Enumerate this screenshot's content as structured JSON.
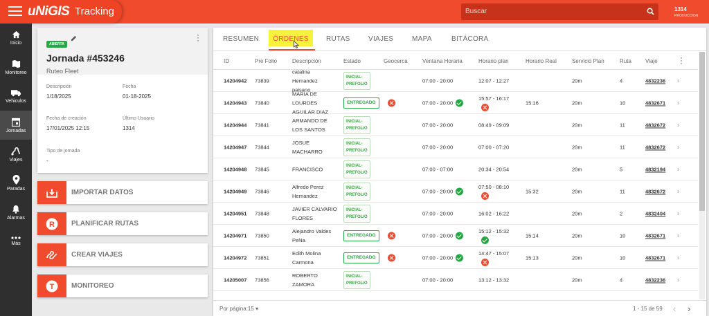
{
  "header": {
    "logo": "uNiGIS",
    "app_title": "Tracking",
    "search_placeholder": "Buscar",
    "user_id": "1314",
    "user_role": "PRODUCCION"
  },
  "sidebar": {
    "items": [
      {
        "label": "Inicio",
        "icon": "home-icon"
      },
      {
        "label": "Monitoreo",
        "icon": "map-icon"
      },
      {
        "label": "Vehiculos",
        "icon": "truck-icon"
      },
      {
        "label": "Jornadas",
        "icon": "calendar-icon"
      },
      {
        "label": "Viajes",
        "icon": "route-icon"
      },
      {
        "label": "Paradas",
        "icon": "pin-icon"
      },
      {
        "label": "Alarmas",
        "icon": "bell-icon"
      },
      {
        "label": "Más",
        "icon": "more-icon"
      }
    ]
  },
  "jornada": {
    "status": "ABIERTA",
    "title": "Jornada #453246",
    "subtitle": "Ruteo Fleet",
    "descripcion_label": "Descripción",
    "descripcion": "1/18/2025",
    "fecha_label": "Fecha",
    "fecha": "01-18-2025",
    "creacion_label": "Fecha de creación",
    "creacion": "17/01/2025 12:15",
    "usuario_label": "Último Usuario",
    "usuario": "1314",
    "tipo_label": "Tipo de jornada",
    "tipo": "-"
  },
  "actions": [
    "IMPORTAR DATOS",
    "PLANIFICAR RUTAS",
    "CREAR VIAJES",
    "MONITOREO"
  ],
  "tabs": [
    "RESUMEN",
    "ÓRDENES",
    "RUTAS",
    "VIAJES",
    "MAPA",
    "BITÁCORA"
  ],
  "columns": [
    "ID",
    "Pre Folio",
    "Descripción",
    "Estado",
    "Geocerca",
    "Ventana Horaria",
    "Horario plan",
    "Horario Real",
    "Servicio Plan",
    "Ruta",
    "Viaje"
  ],
  "rows": [
    {
      "id": "14204942",
      "folio": "73839",
      "desc": [
        "catalina",
        "Hernandez",
        "paisano"
      ],
      "estado": "INICIAL-PREFOLIO",
      "geo": false,
      "ventana": "07:00 - 20:00",
      "ventana_ok": false,
      "plan": "12:07 - 12:27",
      "plan_icon": "",
      "real": "",
      "servicio": "20m",
      "ruta": "4",
      "viaje": "4832236"
    },
    {
      "id": "14204943",
      "folio": "73840",
      "desc": [
        "MARIA DE",
        "LOURDES",
        "AGUILAR DIAZ"
      ],
      "estado": "ENTREGADO",
      "geo": true,
      "ventana": "07:00 - 20:00",
      "ventana_ok": true,
      "plan": "15:57 - 16:17",
      "plan_icon": "x",
      "real": "15:16",
      "servicio": "20m",
      "ruta": "10",
      "viaje": "4832671"
    },
    {
      "id": "14204944",
      "folio": "73841",
      "desc": [
        "ARMANDO DE",
        "LOS SANTOS"
      ],
      "estado": "INICIAL-PREFOLIO",
      "geo": false,
      "ventana": "07:00 - 20:00",
      "ventana_ok": false,
      "plan": "08:49 - 09:09",
      "plan_icon": "",
      "real": "",
      "servicio": "20m",
      "ruta": "11",
      "viaje": "4832672"
    },
    {
      "id": "14204947",
      "folio": "73844",
      "desc": [
        "JOSUE",
        "MACHARRO"
      ],
      "estado": "INICIAL-PREFOLIO",
      "geo": false,
      "ventana": "07:00 - 20:00",
      "ventana_ok": false,
      "plan": "07:00 - 07:20",
      "plan_icon": "",
      "real": "",
      "servicio": "20m",
      "ruta": "11",
      "viaje": "4832672"
    },
    {
      "id": "14204948",
      "folio": "73845",
      "desc": [
        "FRANCISCO"
      ],
      "estado": "INICIAL-PREFOLIO",
      "geo": false,
      "ventana": "07:00 - 07:00",
      "ventana_ok": false,
      "plan": "20:34 - 20:54",
      "plan_icon": "",
      "real": "",
      "servicio": "20m",
      "ruta": "5",
      "viaje": "4832194"
    },
    {
      "id": "14204949",
      "folio": "73846",
      "desc": [
        "Alfredo Perez",
        "Hernandez"
      ],
      "estado": "INICIAL-PREFOLIO",
      "geo": false,
      "ventana": "07:00 - 20:00",
      "ventana_ok": true,
      "plan": "07:50 - 08:10",
      "plan_icon": "x",
      "real": "15:32",
      "servicio": "20m",
      "ruta": "11",
      "viaje": "4832672"
    },
    {
      "id": "14204951",
      "folio": "73848",
      "desc": [
        "JAVIER CALVARIO",
        "FLORES"
      ],
      "estado": "INICIAL-PREFOLIO",
      "geo": false,
      "ventana": "07:00 - 20:00",
      "ventana_ok": false,
      "plan": "16:02 - 16:22",
      "plan_icon": "",
      "real": "",
      "servicio": "20m",
      "ruta": "2",
      "viaje": "4832404"
    },
    {
      "id": "14204971",
      "folio": "73850",
      "desc": [
        "Alejandro Valdes",
        "PeNa"
      ],
      "estado": "ENTREGADO",
      "geo": true,
      "ventana": "07:00 - 20:00",
      "ventana_ok": true,
      "plan": "15:12 - 15:32",
      "plan_icon": "ok",
      "real": "15:14",
      "servicio": "20m",
      "ruta": "10",
      "viaje": "4832671"
    },
    {
      "id": "14204972",
      "folio": "73851",
      "desc": [
        "Edith Molina",
        "Carmona"
      ],
      "estado": "ENTREGADO",
      "geo": true,
      "ventana": "07:00 - 20:00",
      "ventana_ok": true,
      "plan": "14:47 - 15:07",
      "plan_icon": "x",
      "real": "15:13",
      "servicio": "20m",
      "ruta": "10",
      "viaje": "4832671"
    },
    {
      "id": "14205007",
      "folio": "73856",
      "desc": [
        "ROBERTO",
        "ZAMORA"
      ],
      "estado": "INICIAL-PREFOLIO",
      "geo": false,
      "ventana": "07:00 - 20:00",
      "ventana_ok": false,
      "plan": "13:12 - 13:32",
      "plan_icon": "",
      "real": "",
      "servicio": "20m",
      "ruta": "4",
      "viaje": "4832236"
    }
  ],
  "footer": {
    "per_page": "Por página:15",
    "range": "1 - 15 de 59"
  },
  "colors": {
    "brand": "#f04b2c",
    "success": "#28a745",
    "danger": "#ec4b36",
    "highlight": "#f7f23a"
  }
}
